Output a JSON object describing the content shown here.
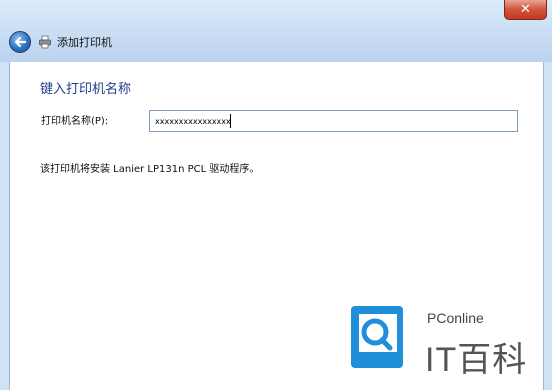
{
  "window": {
    "close_glyph": "✕",
    "title": "添加打印机"
  },
  "icons": {
    "back": "back-arrow-icon",
    "printer": "printer-icon",
    "close": "close-icon",
    "logo": "pconline-logo-icon"
  },
  "content": {
    "heading": "键入打印机名称",
    "name_label": "打印机名称(P):",
    "name_value": "xxxxxxxxxxxxxxxx",
    "info_text": "该打印机将安装 Lanier LP131n PCL 驱动程序。"
  },
  "watermark": {
    "brand": "PConline",
    "name": "IT百科"
  },
  "colors": {
    "accent": "#1e3f8a",
    "frame": "#cfe3f7",
    "close": "#c2391f",
    "logo": "#1e8fd8"
  }
}
